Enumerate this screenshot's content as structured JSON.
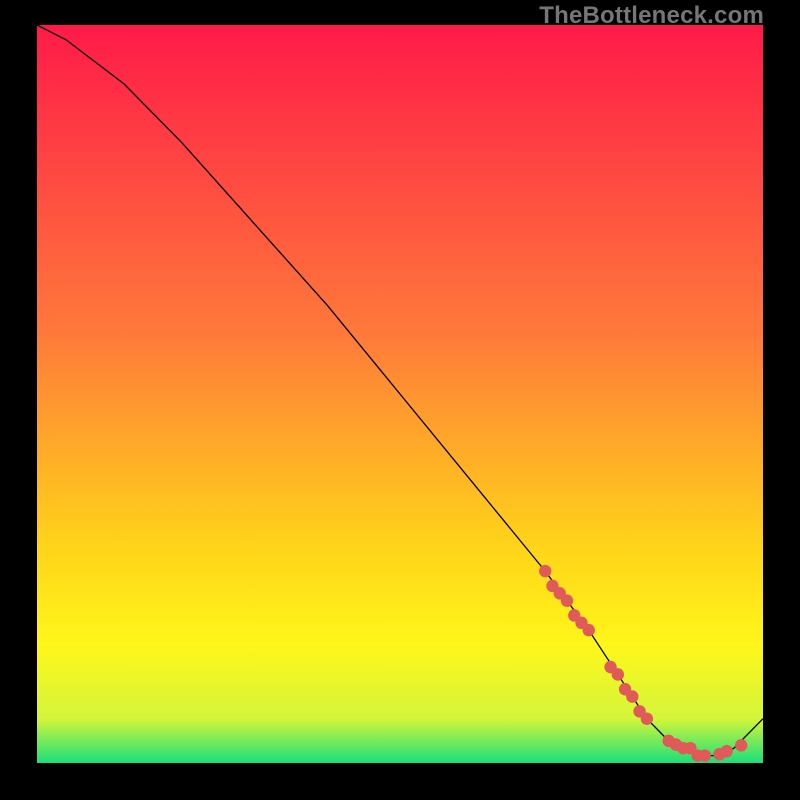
{
  "watermark": "TheBottleneck.com",
  "gradient": {
    "top": "#ff1a49",
    "mid1": "#ff7a3a",
    "mid2": "#ffd21a",
    "mid3": "#fff61a",
    "mid4": "#d4f53a",
    "bottom": "#1adf7a"
  },
  "chart_data": {
    "type": "line",
    "title": "",
    "xlabel": "",
    "ylabel": "",
    "xlim": [
      0,
      100
    ],
    "ylim": [
      0,
      100
    ],
    "series": [
      {
        "name": "bottleneck-curve",
        "x": [
          0,
          4,
          8,
          12,
          20,
          30,
          40,
          50,
          60,
          70,
          76,
          80,
          84,
          88,
          92,
          94,
          96,
          100
        ],
        "values": [
          100,
          98,
          95,
          92,
          84,
          73,
          62,
          50,
          38,
          26,
          18,
          12,
          6,
          2,
          1,
          1,
          2,
          6
        ]
      }
    ],
    "markers": {
      "name": "curve-points",
      "color": "#e05a5a",
      "x": [
        70,
        71,
        72,
        73,
        74,
        75,
        76,
        79,
        80,
        81,
        82,
        83,
        84,
        87,
        88,
        89,
        90,
        91,
        92,
        94,
        95,
        97
      ],
      "values": [
        26,
        24,
        23,
        22,
        20,
        19,
        18,
        13,
        12,
        10,
        9,
        7,
        6,
        3,
        2.5,
        2,
        2,
        1,
        1,
        1.2,
        1.6,
        2.4
      ]
    }
  }
}
